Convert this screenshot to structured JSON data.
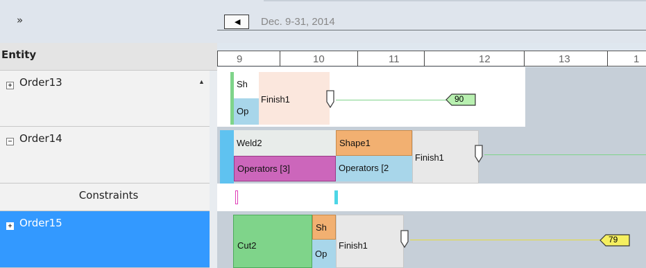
{
  "toolbar": {
    "collapse_icon": "»"
  },
  "entity": {
    "header": "Entity"
  },
  "rows": [
    {
      "label": "Order13",
      "expander": "+"
    },
    {
      "label": "Order14",
      "expander": "−"
    },
    {
      "label": "Constraints"
    },
    {
      "label": "Order15",
      "expander": "+"
    }
  ],
  "timeline": {
    "back_icon": "◀",
    "date_range": "Dec. 9-31, 2014",
    "ticks": [
      "9",
      "10",
      "11",
      "12",
      "13",
      "1"
    ]
  },
  "tasks": {
    "o13_sh": "Sh",
    "o13_op": "Op",
    "o13_finish": "Finish1",
    "o13_flag": "90",
    "o14_weld": "Weld2",
    "o14_operators": "Operators [3]",
    "o14_shape": "Shape1",
    "o14_operators2": "Operators [2",
    "o14_finish": "Finish1",
    "o15_cut": "Cut2",
    "o15_sh": "Sh",
    "o15_op": "Op",
    "o15_finish": "Finish1",
    "o15_flag": "79"
  },
  "colors": {
    "selected_row": "#3399ff",
    "green_task": "#7fd48a",
    "orange_task": "#f2b071",
    "magenta_task": "#cc66bb",
    "blue_task": "#a8d6ea",
    "finish_task": "#fbe7dd",
    "gray_task": "#e8e8e8"
  }
}
